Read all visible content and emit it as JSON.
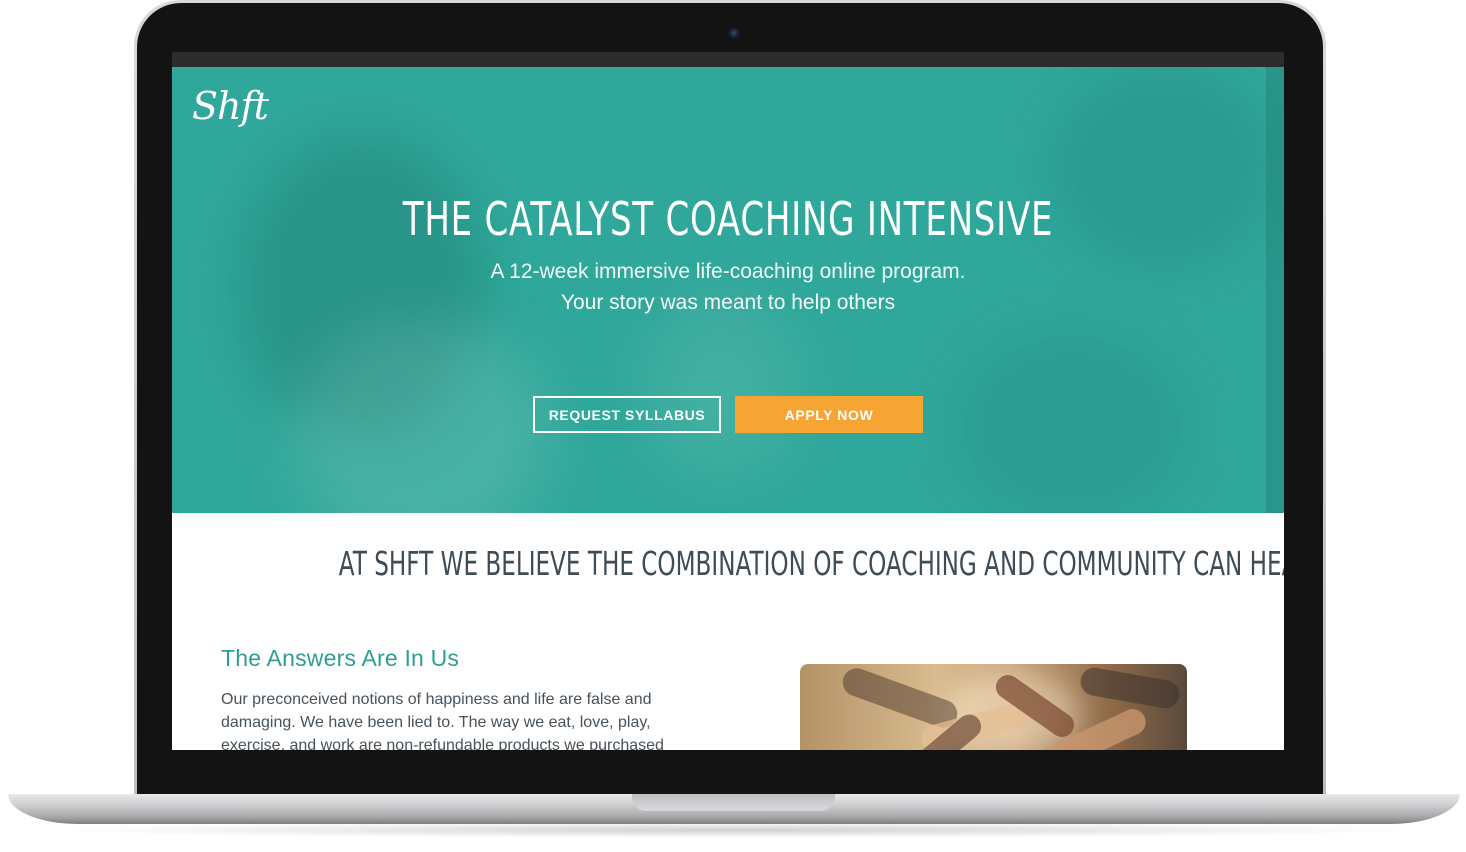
{
  "brand": {
    "logo_text": "Shft",
    "accent_color": "#2fa79a",
    "cta_color": "#f6a433"
  },
  "hero": {
    "title": "THE CATALYST COACHING INTENSIVE",
    "subtitle_line1": "A 12-week immersive life-coaching online program.",
    "subtitle_line2": "Your story was meant to help others",
    "buttons": {
      "request_syllabus": "REQUEST SYLLABUS",
      "apply_now": "APPLY NOW"
    }
  },
  "belief": {
    "text": "AT SHFT WE BELIEVE THE COMBINATION OF COACHING AND COMMUNITY CAN HEAL."
  },
  "answers": {
    "heading": "The Answers Are In Us",
    "body_lines": [
      "Our preconceived notions of happiness and life are false and",
      "damaging. We have been lied to. The way we eat, love, play,",
      "exercise, and work are non-refundable products we purchased"
    ]
  }
}
